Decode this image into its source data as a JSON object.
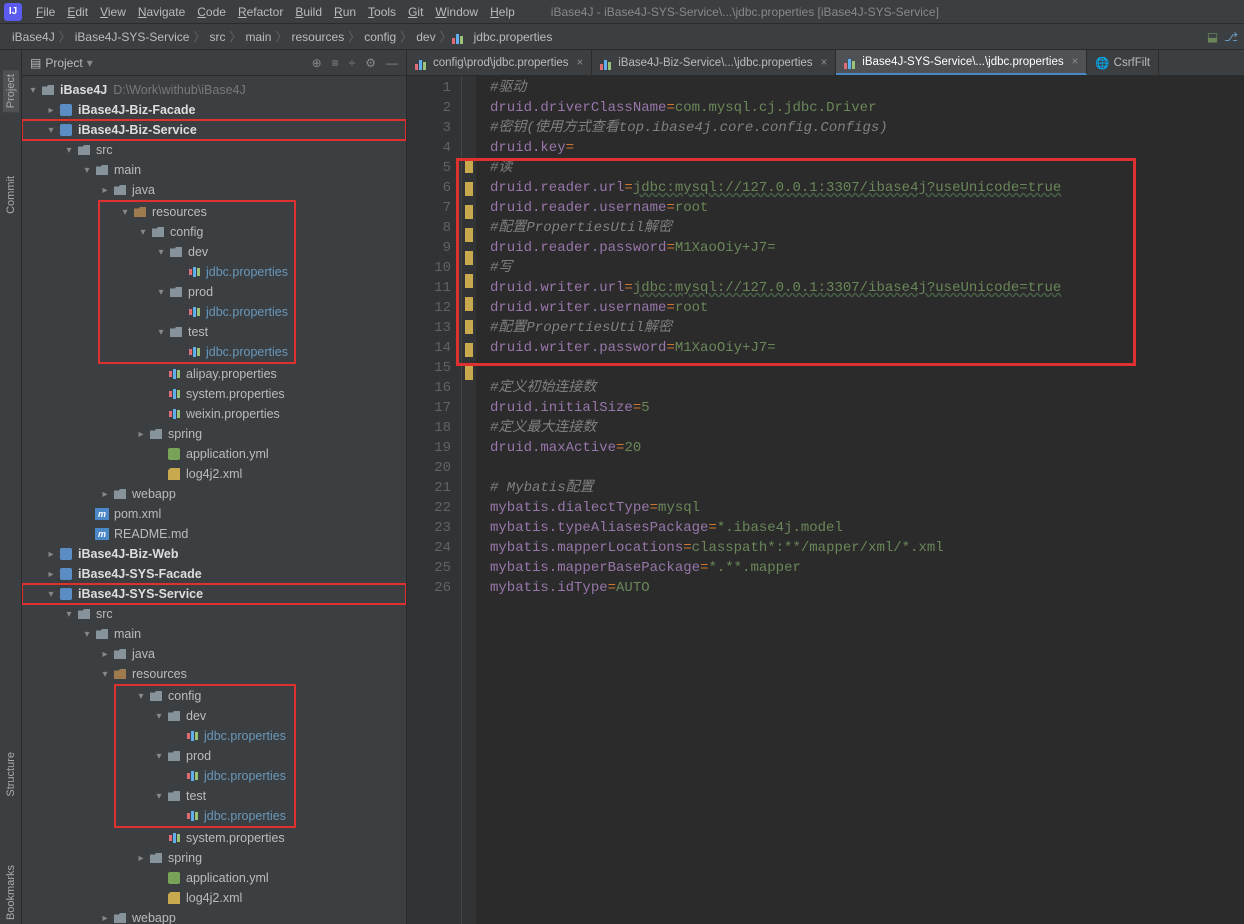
{
  "menubar": {
    "items": [
      "File",
      "Edit",
      "View",
      "Navigate",
      "Code",
      "Refactor",
      "Build",
      "Run",
      "Tools",
      "Git",
      "Window",
      "Help"
    ],
    "title": "iBase4J - iBase4J-SYS-Service\\...\\jdbc.properties [iBase4J-SYS-Service]"
  },
  "breadcrumb": [
    "iBase4J",
    "iBase4J-SYS-Service",
    "src",
    "main",
    "resources",
    "config",
    "dev",
    "jdbc.properties"
  ],
  "side_tabs": {
    "project": "Project",
    "commit": "Commit",
    "structure": "Structure",
    "bookmarks": "Bookmarks"
  },
  "sidebar": {
    "title": "Project",
    "root": {
      "label": "iBase4J",
      "path": "D:\\Work\\withub\\iBase4J"
    },
    "biz_facade": "iBase4J-Biz-Facade",
    "biz_service": "iBase4J-Biz-Service",
    "src": "src",
    "main": "main",
    "java": "java",
    "resources": "resources",
    "config": "config",
    "dev": "dev",
    "prod": "prod",
    "test": "test",
    "jdbc": "jdbc.properties",
    "alipay": "alipay.properties",
    "system": "system.properties",
    "weixin": "weixin.properties",
    "spring": "spring",
    "appyml": "application.yml",
    "log4j2": "log4j2.xml",
    "webapp": "webapp",
    "pom": "pom.xml",
    "readme": "README.md",
    "biz_web": "iBase4J-Biz-Web",
    "sys_facade": "iBase4J-SYS-Facade",
    "sys_service": "iBase4J-SYS-Service"
  },
  "tabs": [
    {
      "label": "config\\prod\\jdbc.properties",
      "active": false
    },
    {
      "label": "iBase4J-Biz-Service\\...\\jdbc.properties",
      "active": false
    },
    {
      "label": "iBase4J-SYS-Service\\...\\jdbc.properties",
      "active": true
    },
    {
      "label": "CsrfFilt",
      "active": false,
      "noclose": true
    }
  ],
  "code": [
    {
      "n": 1,
      "t": "comment",
      "text": "#驱动"
    },
    {
      "n": 2,
      "k": "druid.driverClassName",
      "v": "com.mysql.cj.jdbc.Driver"
    },
    {
      "n": 3,
      "t": "comment",
      "text": "#密钥(使用方式查看top.ibase4j.core.config.Configs)"
    },
    {
      "n": 4,
      "k": "druid.key",
      "v": ""
    },
    {
      "n": 5,
      "t": "comment",
      "text": "#读",
      "m": true
    },
    {
      "n": 6,
      "k": "druid.reader.url",
      "v": "jdbc:mysql://127.0.0.1:3307/ibase4j?useUnicode=true",
      "m": true,
      "link": true
    },
    {
      "n": 7,
      "k": "druid.reader.username",
      "v": "root",
      "m": true
    },
    {
      "n": 8,
      "t": "comment",
      "text": "#配置PropertiesUtil解密",
      "m": true
    },
    {
      "n": 9,
      "k": "druid.reader.password",
      "v": "M1XaoOiy+J7=",
      "m": true
    },
    {
      "n": 10,
      "t": "comment",
      "text": "#写",
      "m": true
    },
    {
      "n": 11,
      "k": "druid.writer.url",
      "v": "jdbc:mysql://127.0.0.1:3307/ibase4j?useUnicode=true",
      "m": true,
      "link": true
    },
    {
      "n": 12,
      "k": "druid.writer.username",
      "v": "root",
      "m": true
    },
    {
      "n": 13,
      "t": "comment",
      "text": "#配置PropertiesUtil解密",
      "m": true
    },
    {
      "n": 14,
      "k": "druid.writer.password",
      "v": "M1XaoOiy+J7=",
      "m": true
    },
    {
      "n": 15,
      "t": "blank"
    },
    {
      "n": 16,
      "t": "comment",
      "text": "#定义初始连接数"
    },
    {
      "n": 17,
      "k": "druid.initialSize",
      "v": "5"
    },
    {
      "n": 18,
      "t": "comment",
      "text": "#定义最大连接数"
    },
    {
      "n": 19,
      "k": "druid.maxActive",
      "v": "20"
    },
    {
      "n": 20,
      "t": "blank"
    },
    {
      "n": 21,
      "t": "comment",
      "text": "# Mybatis配置"
    },
    {
      "n": 22,
      "k": "mybatis.dialectType",
      "v": "mysql"
    },
    {
      "n": 23,
      "k": "mybatis.typeAliasesPackage",
      "v": "*.ibase4j.model"
    },
    {
      "n": 24,
      "k": "mybatis.mapperLocations",
      "v": "classpath*:**/mapper/xml/*.xml"
    },
    {
      "n": 25,
      "k": "mybatis.mapperBasePackage",
      "v": "*.**.mapper"
    },
    {
      "n": 26,
      "k": "mybatis.idType",
      "v": "AUTO"
    }
  ]
}
